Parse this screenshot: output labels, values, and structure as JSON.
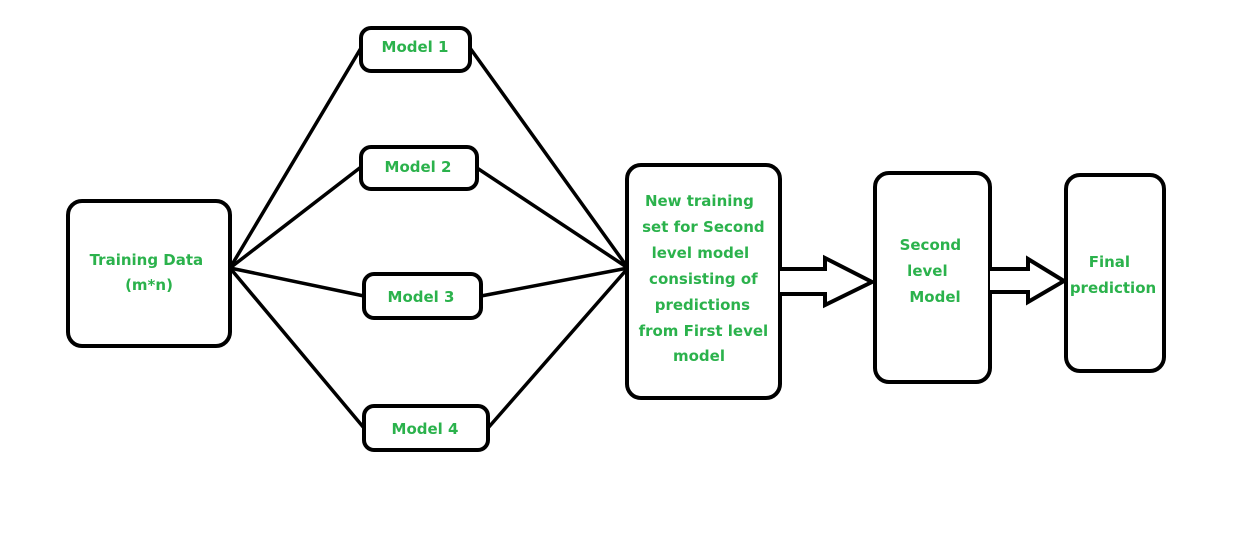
{
  "diagram": {
    "type": "stacking-ensemble-flow",
    "colors": {
      "stroke": "#000000",
      "text": "#2bb24c",
      "background": "#ffffff"
    },
    "nodes": {
      "training_data": {
        "lines": [
          "Training Data",
          "(m*n)"
        ]
      },
      "model_1": {
        "label": "Model 1"
      },
      "model_2": {
        "label": "Model 2"
      },
      "model_3": {
        "label": "Model 3"
      },
      "model_4": {
        "label": "Model 4"
      },
      "new_training_set": {
        "lines": [
          "New training",
          "set for Second",
          "level model",
          "consisting of",
          "predictions",
          "from First level",
          "model"
        ]
      },
      "second_level_model": {
        "lines": [
          "Second",
          "level",
          "Model"
        ]
      },
      "final_prediction": {
        "lines": [
          "Final",
          "prediction"
        ]
      }
    },
    "edges": [
      {
        "from": "training_data",
        "to": "model_1",
        "style": "line"
      },
      {
        "from": "training_data",
        "to": "model_2",
        "style": "line"
      },
      {
        "from": "training_data",
        "to": "model_3",
        "style": "line"
      },
      {
        "from": "training_data",
        "to": "model_4",
        "style": "line"
      },
      {
        "from": "model_1",
        "to": "new_training_set",
        "style": "line"
      },
      {
        "from": "model_2",
        "to": "new_training_set",
        "style": "line"
      },
      {
        "from": "model_3",
        "to": "new_training_set",
        "style": "line"
      },
      {
        "from": "model_4",
        "to": "new_training_set",
        "style": "line"
      },
      {
        "from": "new_training_set",
        "to": "second_level_model",
        "style": "block-arrow"
      },
      {
        "from": "second_level_model",
        "to": "final_prediction",
        "style": "block-arrow"
      }
    ]
  }
}
